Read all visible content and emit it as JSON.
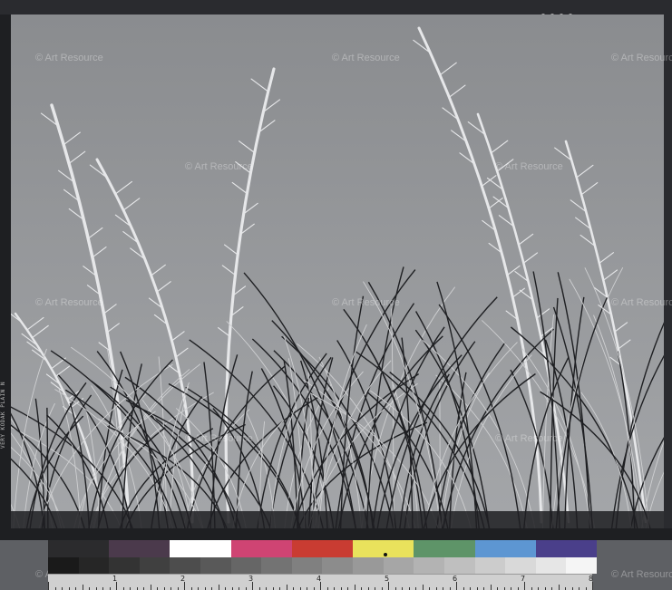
{
  "watermark": {
    "text": "© Art Resource"
  },
  "edge_print": {
    "text": "VERY KODAK PLAIN N"
  },
  "color_swatches": [
    "#2b2b2d",
    "#4b3a4c",
    "#ffffff",
    "#cf4473",
    "#c93c32",
    "#e9e25c",
    "#5e9468",
    "#5d96d2",
    "#4a3f8a"
  ],
  "gray_steps": [
    "#1a1a1a",
    "#262626",
    "#333333",
    "#404040",
    "#4d4d4d",
    "#595959",
    "#666666",
    "#737373",
    "#808080",
    "#8c8c8c",
    "#999999",
    "#a6a6a6",
    "#b3b3b3",
    "#bfbfbf",
    "#cccccc",
    "#d9d9d9",
    "#e6e6e6",
    "#f5f5f5"
  ],
  "ruler": {
    "numbers": [
      "1",
      "2",
      "3",
      "4",
      "5",
      "6",
      "7",
      "8"
    ]
  },
  "photo": {
    "sky_top": "#8a8c8f",
    "sky_bottom": "#a4a6a9",
    "stalk_color": "#e6e7e9",
    "grass_dark": "#1e1f22"
  }
}
